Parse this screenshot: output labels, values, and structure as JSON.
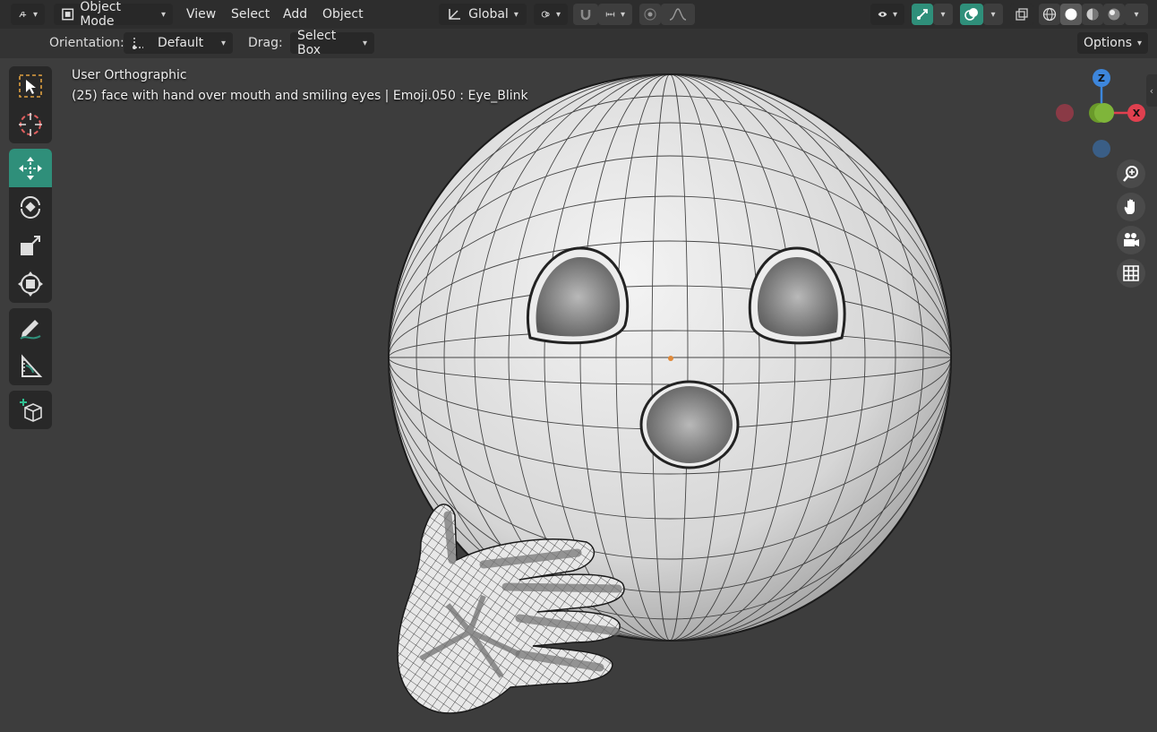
{
  "header": {
    "mode_label": "Object Mode",
    "menus": [
      "View",
      "Select",
      "Add",
      "Object"
    ],
    "transform_orientation": "Global"
  },
  "tool_header": {
    "orientation_label": "Orientation:",
    "orientation_value": "Default",
    "drag_label": "Drag:",
    "drag_value": "Select Box",
    "options_label": "Options"
  },
  "viewport": {
    "view_name": "User Orthographic",
    "object_info": "(25) face with hand over mouth and smiling eyes | Emoji.050 : Eye_Blink"
  },
  "gizmo": {
    "z_label": "Z",
    "x_label": "X",
    "colors": {
      "x": "#e0404f",
      "y": "#7fb53a",
      "z": "#3d86dc"
    }
  },
  "icons": [
    "editor-type-icon",
    "object-mode-icon",
    "transform-orientation-icon",
    "pivot-icon",
    "snap-icon",
    "snap-increment-icon",
    "proportional-edit-icon",
    "falloff-icon",
    "visibility-icon",
    "gizmo-icon",
    "overlay-icon",
    "xray-icon",
    "wireframe-shading-icon",
    "solid-shading-icon",
    "material-shading-icon",
    "rendered-shading-icon",
    "select-box-icon",
    "cursor-icon",
    "move-icon",
    "rotate-icon",
    "scale-icon",
    "transform-icon",
    "annotate-icon",
    "measure-icon",
    "add-cube-icon",
    "zoom-icon",
    "hand-icon",
    "camera-icon",
    "grid-icon"
  ],
  "accent_color": "#2f8f7a"
}
